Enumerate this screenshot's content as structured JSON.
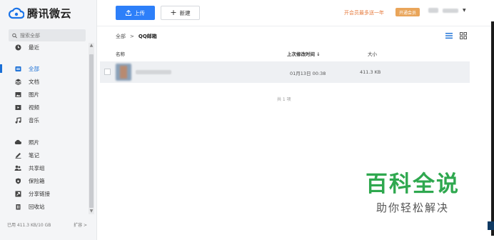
{
  "brand": {
    "name": "腾讯微云"
  },
  "search": {
    "placeholder": "搜索全部"
  },
  "sidebar": {
    "items": [
      {
        "label": "最近",
        "icon": "clock-icon"
      },
      {
        "label": "全部",
        "icon": "folder-icon",
        "active": true
      },
      {
        "label": "文档",
        "icon": "layers-icon"
      },
      {
        "label": "图片",
        "icon": "image-icon"
      },
      {
        "label": "视频",
        "icon": "video-icon"
      },
      {
        "label": "音乐",
        "icon": "music-icon"
      },
      {
        "label": "照片",
        "icon": "cloud-photo-icon"
      },
      {
        "label": "笔记",
        "icon": "pen-icon"
      },
      {
        "label": "共享组",
        "icon": "users-icon"
      },
      {
        "label": "保险箱",
        "icon": "shield-icon"
      },
      {
        "label": "分享链接",
        "icon": "share-link-icon"
      },
      {
        "label": "回收站",
        "icon": "trash-icon"
      }
    ],
    "storage_used": "已用 411.3 KB/10 GB",
    "expand_label": "扩容 >"
  },
  "toolbar": {
    "upload_label": "上传",
    "new_label": "新建",
    "vip_promo": "开会员最多送一年",
    "vip_button": "开通会员"
  },
  "breadcrumb": {
    "root": "全部",
    "separator": ">",
    "current": "QQ邮箱"
  },
  "table": {
    "columns": {
      "name": "名称",
      "modified": "上次修改时间 ↓",
      "size": "大小"
    },
    "rows": [
      {
        "modified": "01月13日 00:38",
        "size": "411.3 KB"
      }
    ],
    "total": "共 1 项"
  },
  "watermark": {
    "title": "百科全说",
    "subtitle": "助你轻松解决"
  },
  "colors": {
    "accent": "#2d7ff9",
    "active_nav": "#1a6fd6",
    "vip": "#e67a3c",
    "watermark": "#2fa84f"
  }
}
